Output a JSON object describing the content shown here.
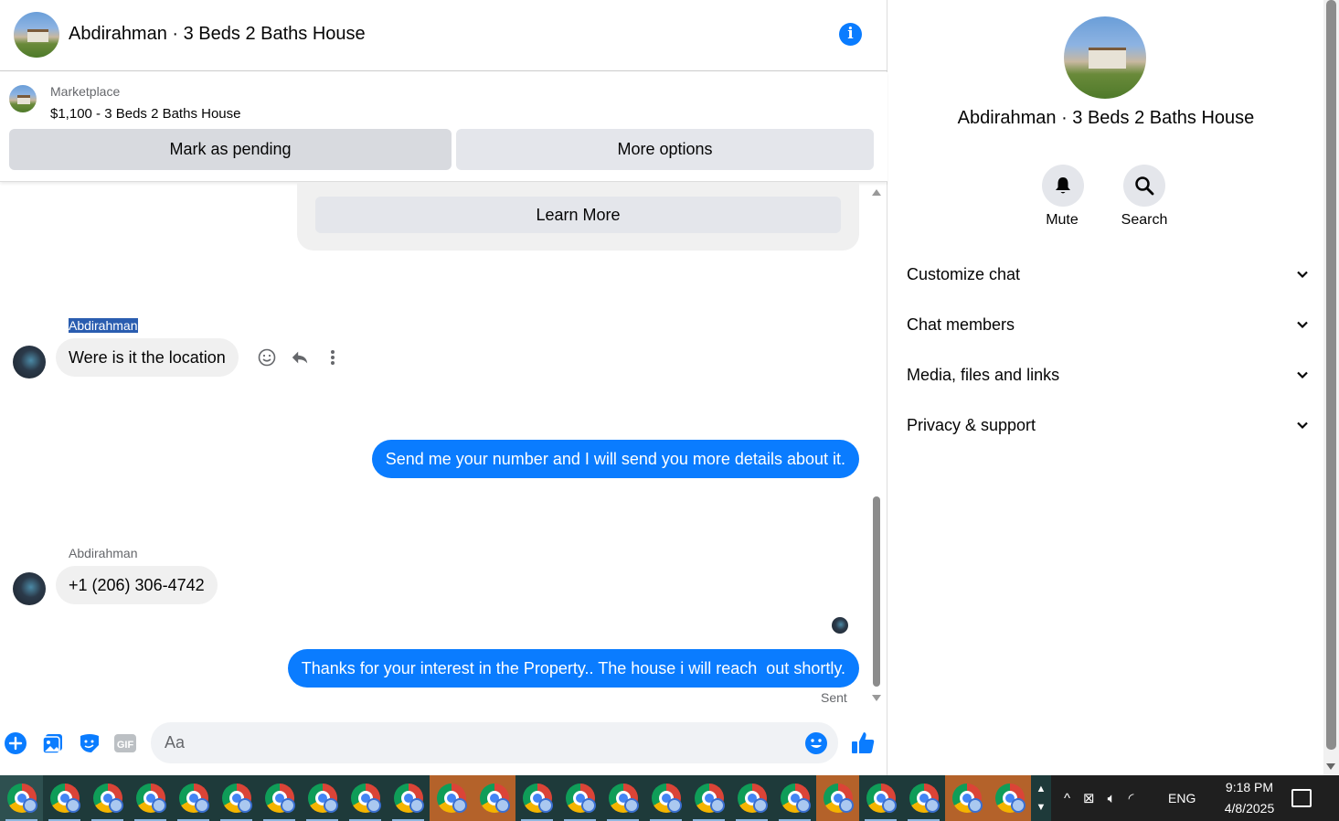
{
  "header": {
    "title": "Abdirahman · 3 Beds 2 Baths House",
    "info_icon": "info-icon"
  },
  "listing": {
    "category": "Marketplace",
    "title": "$1,100 - 3 Beds 2 Baths House",
    "pending_label": "Mark as pending",
    "more_label": "More options"
  },
  "messages": {
    "learn_more_label": "Learn More",
    "sender1": "Abdirahman",
    "msg1": "Were is it the location",
    "msg2": "Send me your number and I will send you more details about it.",
    "sender2": "Abdirahman",
    "msg3": "+1 (206) 306-4742",
    "msg4": "Thanks for your interest in the Property.. The house i will reach  out shortly.",
    "sent_label": "Sent"
  },
  "composer": {
    "placeholder": "Aa"
  },
  "details": {
    "title": "Abdirahman · 3 Beds 2 Baths House",
    "mute_label": "Mute",
    "search_label": "Search",
    "sections": [
      "Customize chat",
      "Chat members",
      "Media, files and links",
      "Privacy & support"
    ]
  },
  "taskbar": {
    "lang": "ENG",
    "time": "9:18 PM",
    "date": "4/8/2025",
    "accent_orange": "#b4622a"
  }
}
